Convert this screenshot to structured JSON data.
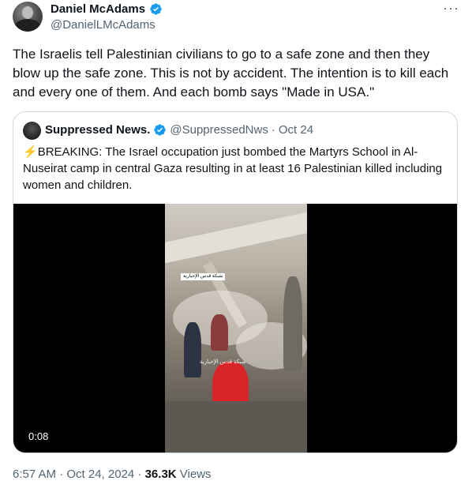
{
  "author": {
    "name": "Daniel McAdams",
    "handle": "@DanielLMcAdams",
    "avatar_icon": "avatar-photo-icon",
    "verified_icon": "verified-badge-icon",
    "verified_color": "#1d9bf0"
  },
  "more_label": "···",
  "tweet_text": "The Israelis tell Palestinian civilians to go to a safe zone and then they blow up the safe zone. This is not by accident. The intention is to kill each and every one of them. And each bomb says \"Made in USA.\"",
  "quote": {
    "name": "Suppressed News.",
    "handle": "@SuppressedNws",
    "separator": "·",
    "date": "Oct 24",
    "bolt": "⚡",
    "text": "BREAKING: The Israel occupation just bombed the Martyrs School in Al-Nuseirat camp in central Gaza resulting in at least 16 Palestinian killed including women and children.",
    "video": {
      "timecode": "0:08",
      "overlay_label": "شبكة قدس الإخبارية",
      "watermark": "شبكة قدس الإخبارية"
    }
  },
  "meta": {
    "time_date": "6:57 AM · Oct 24, 2024 · ",
    "views_count": "36.3K",
    "views_label": " Views"
  }
}
